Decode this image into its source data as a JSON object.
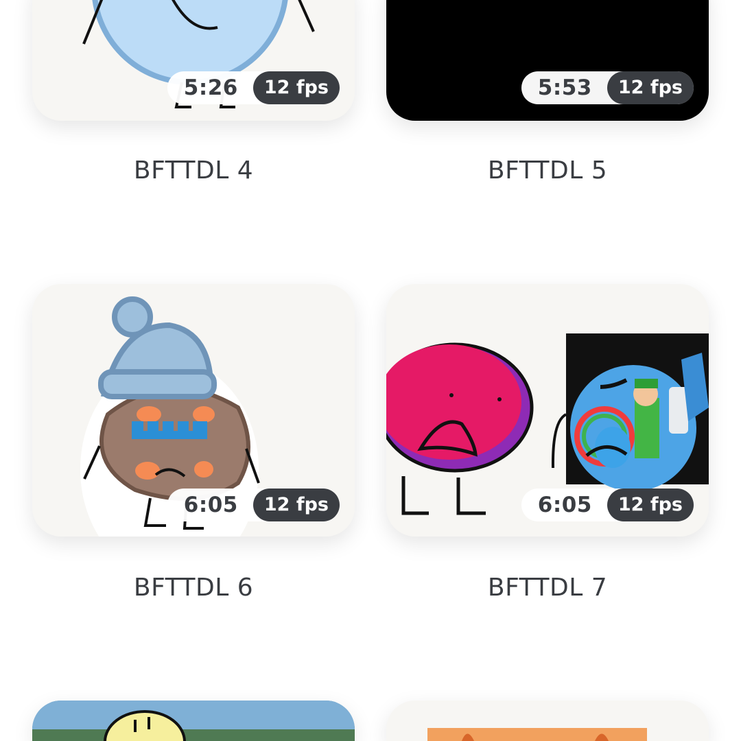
{
  "videos": [
    {
      "title": "BFTTDL 4",
      "duration": "5:26",
      "fps": "12 fps"
    },
    {
      "title": "BFTTDL 5",
      "duration": "5:53",
      "fps": "12 fps"
    },
    {
      "title": "BFTTDL 6",
      "duration": "6:05",
      "fps": "12 fps"
    },
    {
      "title": "BFTTDL 7",
      "duration": "6:05",
      "fps": "12 fps"
    }
  ]
}
